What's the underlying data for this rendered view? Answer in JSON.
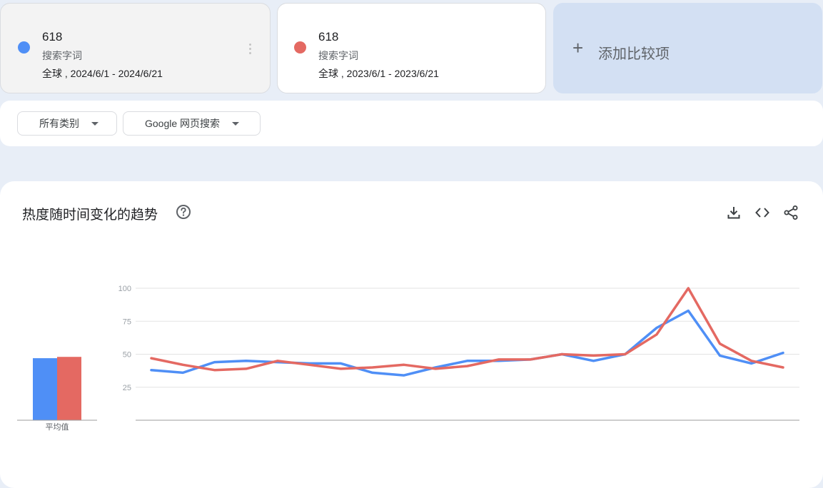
{
  "terms": [
    {
      "name": "618",
      "type": "搜索字词",
      "range": "全球 , 2024/6/1 - 2024/6/21",
      "color": "#4f8ff6"
    },
    {
      "name": "618",
      "type": "搜索字词",
      "range": "全球 , 2023/6/1 - 2023/6/21",
      "color": "#e46962"
    }
  ],
  "add_compare": {
    "icon": "plus-icon",
    "label": "添加比较项"
  },
  "filters": {
    "category": "所有类别",
    "search_type": "Google 网页搜索"
  },
  "panel": {
    "title": "热度随时间变化的趋势",
    "icons": [
      "help-icon",
      "download-icon",
      "embed-code-icon",
      "share-icon"
    ]
  },
  "chart_data": {
    "type": "line",
    "y_ticks": [
      "100",
      "75",
      "50",
      "25"
    ],
    "ylim": [
      0,
      100
    ],
    "grid": true,
    "series": [
      {
        "name": "618",
        "color": "#4f8ff6",
        "values": [
          38,
          36,
          44,
          45,
          44,
          43,
          43,
          36,
          34,
          40,
          45,
          45,
          46,
          50,
          45,
          50,
          70,
          83,
          49,
          43,
          51
        ]
      },
      {
        "name": "618",
        "color": "#e46962",
        "values": [
          47,
          42,
          38,
          39,
          45,
          42,
          39,
          40,
          42,
          39,
          41,
          46,
          46,
          50,
          49,
          50,
          65,
          100,
          58,
          45,
          40
        ]
      }
    ],
    "average": {
      "label": "平均值",
      "values": [
        47,
        48
      ]
    }
  }
}
